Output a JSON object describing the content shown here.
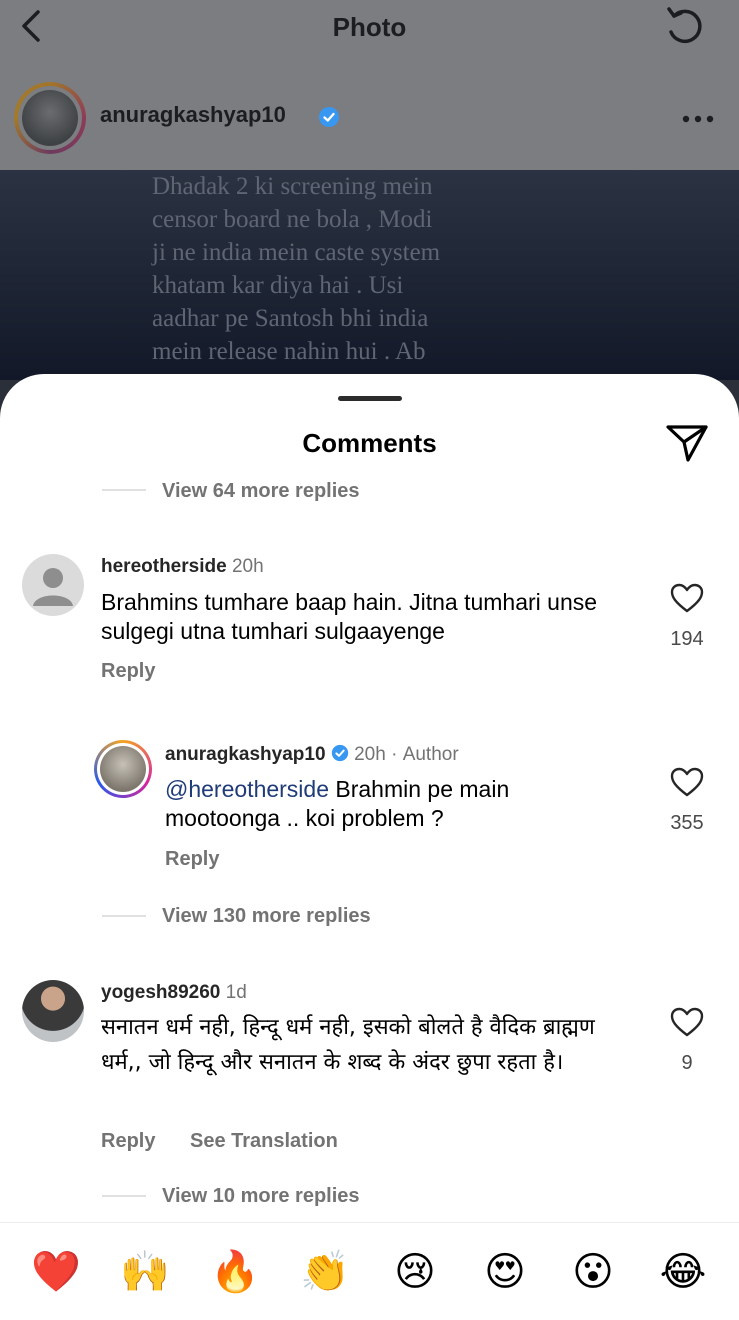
{
  "header": {
    "title": "Photo"
  },
  "post": {
    "username": "anuragkashyap10",
    "caption_lines": "Dhadak 2 ki screening mein\ncensor board ne bola , Modi\nji ne india mein caste system\nkhatam kar diya hai . Usi\naadhar pe Santosh bhi india\nmein release nahin hui . Ab"
  },
  "comments_sheet": {
    "title": "Comments",
    "view_replies_top": "View 64 more replies",
    "comments": [
      {
        "username": "hereotherside",
        "time": "20h",
        "text": "Brahmins tumhare baap hain. Jitna tumhari unse sulgegi utna tumhari sulgaayenge",
        "likes": "194",
        "reply_label": "Reply"
      },
      {
        "username": "anuragkashyap10",
        "time": "20h",
        "author_tag": "Author",
        "mention": "@hereotherside",
        "text": " Brahmin pe main mootoonga .. koi problem ?",
        "likes": "355",
        "reply_label": "Reply"
      },
      {
        "username": "yogesh89260",
        "time": "1d",
        "text": "सनातन धर्म नही, हिन्दू धर्म नही, इसको बोलते है वैदिक ब्राह्मण धर्म,, जो हिन्दू और सनातन के शब्द के अंदर छुपा रहता है।",
        "likes": "9",
        "reply_label": "Reply",
        "translate_label": "See Translation"
      }
    ],
    "view_replies_mid": "View 130 more replies",
    "view_replies_bottom": "View 10 more replies"
  },
  "emoji_bar": [
    "❤️",
    "🙌",
    "🔥",
    "👏",
    "😢",
    "😍",
    "😮",
    "😂"
  ],
  "colors": {
    "verified": "#3897f0",
    "mention": "#1f3b78",
    "secondary_text": "#737373"
  },
  "icons": {
    "back": "chevron-left-icon",
    "refresh": "refresh-icon",
    "more": "more-horizontal-icon",
    "share": "send-icon",
    "like": "heart-icon"
  }
}
